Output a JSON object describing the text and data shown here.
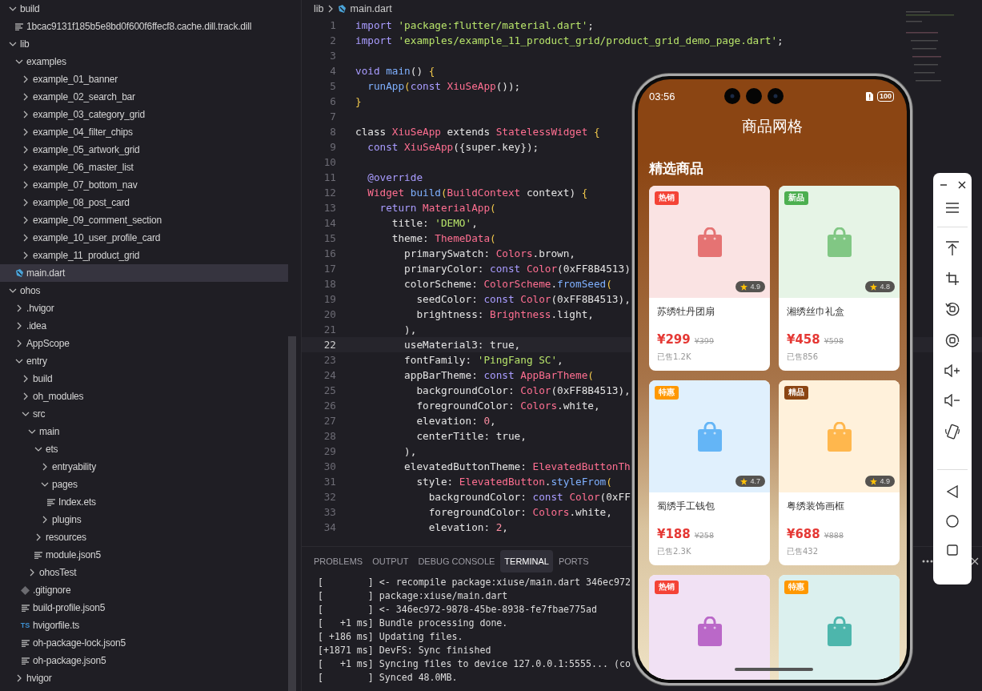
{
  "explorer": {
    "items": [
      {
        "name": "build",
        "kind": "folder",
        "expanded": true,
        "selected": false,
        "children": [
          {
            "name": "1bcac9131f185b5e8bd0f600f6ffecf8.cache.dill.track.dill",
            "kind": "file",
            "selected": false
          }
        ]
      },
      {
        "name": "lib",
        "kind": "folder",
        "expanded": true,
        "selected": false,
        "children": [
          {
            "name": "examples",
            "kind": "folder",
            "expanded": true,
            "selected": false,
            "children": [
              {
                "name": "example_01_banner",
                "kind": "folder",
                "expanded": false,
                "selected": false
              },
              {
                "name": "example_02_search_bar",
                "kind": "folder",
                "expanded": false,
                "selected": false
              },
              {
                "name": "example_03_category_grid",
                "kind": "folder",
                "expanded": false,
                "selected": false
              },
              {
                "name": "example_04_filter_chips",
                "kind": "folder",
                "expanded": false,
                "selected": false
              },
              {
                "name": "example_05_artwork_grid",
                "kind": "folder",
                "expanded": false,
                "selected": false
              },
              {
                "name": "example_06_master_list",
                "kind": "folder",
                "expanded": false,
                "selected": false
              },
              {
                "name": "example_07_bottom_nav",
                "kind": "folder",
                "expanded": false,
                "selected": false
              },
              {
                "name": "example_08_post_card",
                "kind": "folder",
                "expanded": false,
                "selected": false
              },
              {
                "name": "example_09_comment_section",
                "kind": "folder",
                "expanded": false,
                "selected": false
              },
              {
                "name": "example_10_user_profile_card",
                "kind": "folder",
                "expanded": false,
                "selected": false
              },
              {
                "name": "example_11_product_grid",
                "kind": "folder",
                "expanded": false,
                "selected": false
              }
            ]
          },
          {
            "name": "main.dart",
            "kind": "dart",
            "selected": true
          }
        ]
      },
      {
        "name": "ohos",
        "kind": "folder",
        "expanded": true,
        "selected": false,
        "children": [
          {
            "name": ".hvigor",
            "kind": "folder",
            "expanded": false,
            "selected": false
          },
          {
            "name": ".idea",
            "kind": "folder",
            "expanded": false,
            "selected": false
          },
          {
            "name": "AppScope",
            "kind": "folder",
            "expanded": false,
            "selected": false
          },
          {
            "name": "entry",
            "kind": "folder",
            "expanded": true,
            "selected": false,
            "children": [
              {
                "name": "build",
                "kind": "folder",
                "expanded": false,
                "selected": false
              },
              {
                "name": "oh_modules",
                "kind": "folder",
                "expanded": false,
                "selected": false
              },
              {
                "name": "src",
                "kind": "folder",
                "expanded": true,
                "selected": false,
                "children": [
                  {
                    "name": "main",
                    "kind": "folder",
                    "expanded": true,
                    "selected": false,
                    "children": [
                      {
                        "name": "ets",
                        "kind": "folder",
                        "expanded": true,
                        "selected": false,
                        "children": [
                          {
                            "name": "entryability",
                            "kind": "folder",
                            "expanded": false,
                            "selected": false
                          },
                          {
                            "name": "pages",
                            "kind": "folder",
                            "expanded": true,
                            "selected": false,
                            "children": [
                              {
                                "name": "Index.ets",
                                "kind": "file",
                                "selected": false
                              }
                            ]
                          },
                          {
                            "name": "plugins",
                            "kind": "folder",
                            "expanded": false,
                            "selected": false
                          }
                        ]
                      },
                      {
                        "name": "resources",
                        "kind": "folder",
                        "expanded": false,
                        "selected": false
                      },
                      {
                        "name": "module.json5",
                        "kind": "file",
                        "selected": false
                      }
                    ]
                  },
                  {
                    "name": "ohosTest",
                    "kind": "folder",
                    "expanded": false,
                    "selected": false
                  }
                ]
              },
              {
                "name": ".gitignore",
                "kind": "git",
                "selected": false
              },
              {
                "name": "build-profile.json5",
                "kind": "file",
                "selected": false
              },
              {
                "name": "hvigorfile.ts",
                "kind": "ts",
                "badge": "TS",
                "selected": false
              },
              {
                "name": "oh-package-lock.json5",
                "kind": "file",
                "selected": false
              },
              {
                "name": "oh-package.json5",
                "kind": "file",
                "selected": false
              }
            ]
          },
          {
            "name": "hvigor",
            "kind": "folder",
            "expanded": false,
            "selected": false
          }
        ]
      }
    ]
  },
  "breadcrumb": {
    "folder": "lib",
    "file": "main.dart"
  },
  "code_lines": [
    {
      "number": "1",
      "current": false,
      "tokens": [
        {
          "text": "import ",
          "kind": "kw"
        },
        {
          "text": "'package:flutter/material.dart'",
          "kind": "str"
        },
        {
          "text": ";",
          "kind": "pl"
        }
      ]
    },
    {
      "number": "2",
      "current": false,
      "tokens": [
        {
          "text": "import ",
          "kind": "kw"
        },
        {
          "text": "'examples/example_11_product_grid/product_grid_demo_page.dart'",
          "kind": "str"
        },
        {
          "text": ";",
          "kind": "pl"
        }
      ]
    },
    {
      "number": "3",
      "current": false
    },
    {
      "number": "4",
      "current": false,
      "tokens": [
        {
          "text": "void ",
          "kind": "kw"
        },
        {
          "text": "main",
          "kind": "fn"
        },
        {
          "text": "() ",
          "kind": "pl"
        },
        {
          "text": "{",
          "kind": "br"
        }
      ]
    },
    {
      "number": "5",
      "current": false,
      "tokens": [
        {
          "text": "  runApp",
          "kind": "fn"
        },
        {
          "text": "(",
          "kind": "br"
        },
        {
          "text": "const ",
          "kind": "kw"
        },
        {
          "text": "XiuSeApp",
          "kind": "ty"
        },
        {
          "text": "());",
          "kind": "pl"
        }
      ]
    },
    {
      "number": "6",
      "current": false,
      "tokens": [
        {
          "text": "}",
          "kind": "br"
        }
      ]
    },
    {
      "number": "7",
      "current": false
    },
    {
      "number": "8",
      "current": false,
      "tokens": [
        {
          "text": "class ",
          "kind": "pl"
        },
        {
          "text": "XiuSeApp ",
          "kind": "ty"
        },
        {
          "text": "extends ",
          "kind": "pl"
        },
        {
          "text": "StatelessWidget ",
          "kind": "ty"
        },
        {
          "text": "{",
          "kind": "br"
        }
      ]
    },
    {
      "number": "9",
      "current": false,
      "tokens": [
        {
          "text": "  const ",
          "kind": "kw"
        },
        {
          "text": "XiuSeApp",
          "kind": "ty"
        },
        {
          "text": "({super.key});",
          "kind": "pl"
        }
      ]
    },
    {
      "number": "10",
      "current": false
    },
    {
      "number": "11",
      "current": false,
      "tokens": [
        {
          "text": "  @override",
          "kind": "kw"
        }
      ]
    },
    {
      "number": "12",
      "current": false,
      "tokens": [
        {
          "text": "  Widget ",
          "kind": "ty"
        },
        {
          "text": "build",
          "kind": "fn"
        },
        {
          "text": "(",
          "kind": "br"
        },
        {
          "text": "BuildContext ",
          "kind": "ty"
        },
        {
          "text": "context) ",
          "kind": "pl"
        },
        {
          "text": "{",
          "kind": "br"
        }
      ]
    },
    {
      "number": "13",
      "current": false,
      "tokens": [
        {
          "text": "    return ",
          "kind": "kw"
        },
        {
          "text": "MaterialApp",
          "kind": "ty"
        },
        {
          "text": "(",
          "kind": "br"
        }
      ]
    },
    {
      "number": "14",
      "current": false,
      "tokens": [
        {
          "text": "      title: ",
          "kind": "pl"
        },
        {
          "text": "'DEMO'",
          "kind": "str"
        },
        {
          "text": ",",
          "kind": "pl"
        }
      ]
    },
    {
      "number": "15",
      "current": false,
      "tokens": [
        {
          "text": "      theme: ",
          "kind": "pl"
        },
        {
          "text": "ThemeData",
          "kind": "ty"
        },
        {
          "text": "(",
          "kind": "br"
        }
      ]
    },
    {
      "number": "16",
      "current": false,
      "tokens": [
        {
          "text": "        primarySwatch: ",
          "kind": "pl"
        },
        {
          "text": "Colors",
          "kind": "ty"
        },
        {
          "text": ".brown,",
          "kind": "pl"
        }
      ]
    },
    {
      "number": "17",
      "current": false,
      "tokens": [
        {
          "text": "        primaryColor: ",
          "kind": "pl"
        },
        {
          "text": "const ",
          "kind": "kw"
        },
        {
          "text": "Color",
          "kind": "ty"
        },
        {
          "text": "(0xFF8B4513)",
          "kind": "pl"
        }
      ]
    },
    {
      "number": "18",
      "current": false,
      "tokens": [
        {
          "text": "        colorScheme: ",
          "kind": "pl"
        },
        {
          "text": "ColorScheme",
          "kind": "ty"
        },
        {
          "text": ".",
          "kind": "pl"
        },
        {
          "text": "fromSeed",
          "kind": "fn"
        },
        {
          "text": "(",
          "kind": "br"
        }
      ]
    },
    {
      "number": "19",
      "current": false,
      "tokens": [
        {
          "text": "          seedColor: ",
          "kind": "pl"
        },
        {
          "text": "const ",
          "kind": "kw"
        },
        {
          "text": "Color",
          "kind": "ty"
        },
        {
          "text": "(0xFF8B4513),",
          "kind": "pl"
        }
      ]
    },
    {
      "number": "20",
      "current": false,
      "tokens": [
        {
          "text": "          brightness: ",
          "kind": "pl"
        },
        {
          "text": "Brightness",
          "kind": "ty"
        },
        {
          "text": ".light,",
          "kind": "pl"
        }
      ]
    },
    {
      "number": "21",
      "current": false,
      "tokens": [
        {
          "text": "        ),",
          "kind": "pl"
        }
      ]
    },
    {
      "number": "22",
      "current": true,
      "tokens": [
        {
          "text": "        useMaterial3: true,",
          "kind": "pl"
        }
      ]
    },
    {
      "number": "23",
      "current": false,
      "tokens": [
        {
          "text": "        fontFamily: ",
          "kind": "pl"
        },
        {
          "text": "'PingFang SC'",
          "kind": "str"
        },
        {
          "text": ",",
          "kind": "pl"
        }
      ]
    },
    {
      "number": "24",
      "current": false,
      "tokens": [
        {
          "text": "        appBarTheme: ",
          "kind": "pl"
        },
        {
          "text": "const ",
          "kind": "kw"
        },
        {
          "text": "AppBarTheme",
          "kind": "ty"
        },
        {
          "text": "(",
          "kind": "br"
        }
      ]
    },
    {
      "number": "25",
      "current": false,
      "tokens": [
        {
          "text": "          backgroundColor: ",
          "kind": "pl"
        },
        {
          "text": "Color",
          "kind": "ty"
        },
        {
          "text": "(0xFF8B4513),",
          "kind": "pl"
        }
      ]
    },
    {
      "number": "26",
      "current": false,
      "tokens": [
        {
          "text": "          foregroundColor: ",
          "kind": "pl"
        },
        {
          "text": "Colors",
          "kind": "ty"
        },
        {
          "text": ".white,",
          "kind": "pl"
        }
      ]
    },
    {
      "number": "27",
      "current": false,
      "tokens": [
        {
          "text": "          elevation: ",
          "kind": "pl"
        },
        {
          "text": "0",
          "kind": "num"
        },
        {
          "text": ",",
          "kind": "pl"
        }
      ]
    },
    {
      "number": "28",
      "current": false,
      "tokens": [
        {
          "text": "          centerTitle: true,",
          "kind": "pl"
        }
      ]
    },
    {
      "number": "29",
      "current": false,
      "tokens": [
        {
          "text": "        ),",
          "kind": "pl"
        }
      ]
    },
    {
      "number": "30",
      "current": false,
      "tokens": [
        {
          "text": "        elevatedButtonTheme: ",
          "kind": "pl"
        },
        {
          "text": "ElevatedButtonTh",
          "kind": "ty"
        }
      ]
    },
    {
      "number": "31",
      "current": false,
      "tokens": [
        {
          "text": "          style: ",
          "kind": "pl"
        },
        {
          "text": "ElevatedButton",
          "kind": "ty"
        },
        {
          "text": ".",
          "kind": "pl"
        },
        {
          "text": "styleFrom",
          "kind": "fn"
        },
        {
          "text": "(",
          "kind": "br"
        }
      ]
    },
    {
      "number": "32",
      "current": false,
      "tokens": [
        {
          "text": "            backgroundColor: ",
          "kind": "pl"
        },
        {
          "text": "const ",
          "kind": "kw"
        },
        {
          "text": "Color",
          "kind": "ty"
        },
        {
          "text": "(0xFF",
          "kind": "pl"
        }
      ]
    },
    {
      "number": "33",
      "current": false,
      "tokens": [
        {
          "text": "            foregroundColor: ",
          "kind": "pl"
        },
        {
          "text": "Colors",
          "kind": "ty"
        },
        {
          "text": ".white,",
          "kind": "pl"
        }
      ]
    },
    {
      "number": "34",
      "current": false,
      "tokens": [
        {
          "text": "            elevation: ",
          "kind": "pl"
        },
        {
          "text": "2",
          "kind": "num"
        },
        {
          "text": ",",
          "kind": "pl"
        }
      ]
    }
  ],
  "panel": {
    "tabs": [
      {
        "label": "PROBLEMS",
        "selected": false
      },
      {
        "label": "OUTPUT",
        "selected": false
      },
      {
        "label": "DEBUG CONSOLE",
        "selected": false
      },
      {
        "label": "TERMINAL",
        "selected": true
      },
      {
        "label": "PORTS",
        "selected": false
      }
    ],
    "terminal_lines": [
      "[        ] <- recompile package:xiuse/main.dart 346ec972",
      "[        ] package:xiuse/main.dart",
      "[        ] <- 346ec972-9878-45be-8938-fe7fbae775ad",
      "[   +1 ms] Bundle processing done.",
      "[ +186 ms] Updating files.",
      "[+1871 ms] DevFS: Sync finished",
      "[   +1 ms] Syncing files to device 127.0.0.1:5555... (co",
      "[        ] Synced 48.0MB."
    ]
  },
  "phone": {
    "time": "03:56",
    "battery": "100",
    "title": "商品网格",
    "section": "精选商品",
    "products": [
      {
        "tag": {
          "label": "热销",
          "color": "#f44336"
        },
        "color": "#e57373",
        "rating": "4.9",
        "name": "苏绣牡丹团扇",
        "price": "¥299",
        "original_price": "¥399",
        "sold": "已售1.2K"
      },
      {
        "tag": {
          "label": "新品",
          "color": "#4caf50"
        },
        "color": "#81c784",
        "rating": "4.8",
        "name": "湘绣丝巾礼盒",
        "price": "¥458",
        "original_price": "¥598",
        "sold": "已售856"
      },
      {
        "tag": {
          "label": "特惠",
          "color": "#ff9800"
        },
        "color": "#64b5f6",
        "rating": "4.7",
        "name": "蜀绣手工钱包",
        "price": "¥188",
        "original_price": "¥258",
        "sold": "已售2.3K"
      },
      {
        "tag": {
          "label": "精品",
          "color": "#8b4513"
        },
        "color": "#ffb74d",
        "rating": "4.9",
        "name": "粤绣装饰画框",
        "price": "¥688",
        "original_price": "¥888",
        "sold": "已售432"
      },
      {
        "tag": {
          "label": "热销",
          "color": "#f44336"
        },
        "color": "#ba68c8"
      },
      {
        "tag": {
          "label": "特惠",
          "color": "#ff9800"
        },
        "color": "#4db6ac"
      }
    ]
  }
}
